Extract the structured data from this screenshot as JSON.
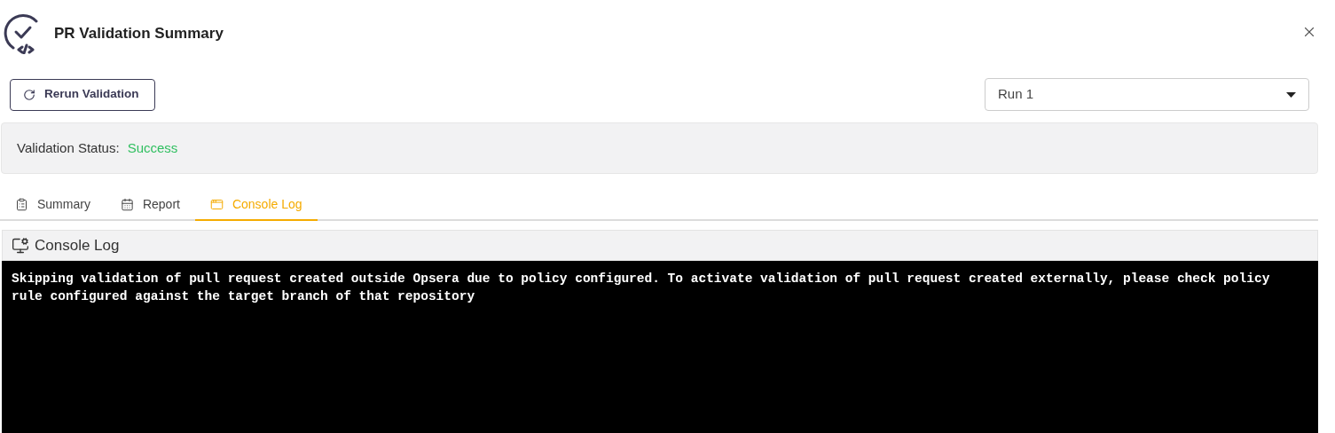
{
  "dialog": {
    "title": "PR Validation Summary"
  },
  "rerun_button": {
    "label": "Rerun Validation"
  },
  "run_select": {
    "value": "Run 1"
  },
  "status": {
    "label": "Validation Status:",
    "value": "Success",
    "kind": "success"
  },
  "tabs": [
    {
      "label": "Summary",
      "kind": "summary",
      "selected": false
    },
    {
      "label": "Report",
      "kind": "report",
      "selected": false
    },
    {
      "label": "Console Log",
      "kind": "console",
      "selected": true
    }
  ],
  "console": {
    "title": "Console Log",
    "lines": [
      "Skipping validation of pull request created outside Opsera due to policy configured. To activate validation of pull request created externally, please check policy",
      "rule configured against the target branch of that repository"
    ]
  }
}
